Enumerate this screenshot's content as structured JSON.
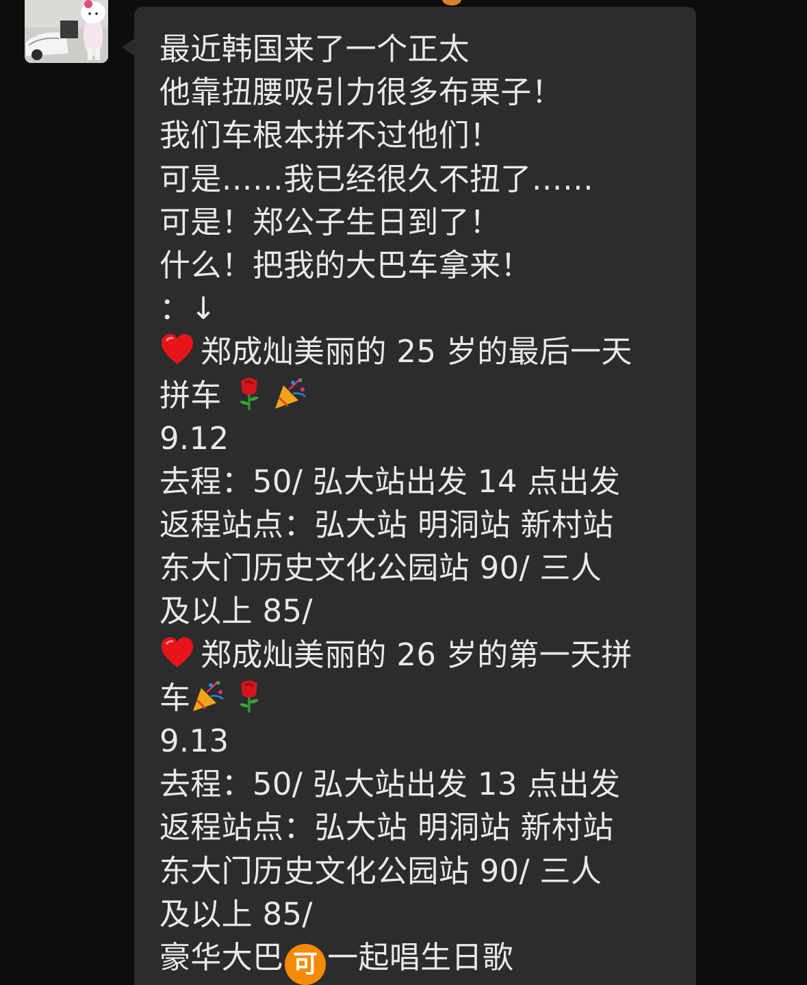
{
  "chat": {
    "avatar_icon": "hello-kitty-mascot-avatar",
    "message": {
      "line1": "最近韩国来了一个正太",
      "line2": "他靠扭腰吸引力很多布栗子！",
      "line3": "我们车根本拼不过他们！",
      "line4": "可是……我已经很久不扭了……",
      "line5": "可是！郑公子生日到了！",
      "line6": "什么！把我的大巴车拿来！",
      "line7": "：↓",
      "line8_icon": "red-heart-icon",
      "line8": "郑成灿美丽的 25 岁的最后一天",
      "line9": "拼车",
      "line9_icons": [
        "rose-icon",
        "party-popper-icon"
      ],
      "line10": "9.12",
      "line11": "去程：50/ 弘大站出发 14 点出发",
      "line12": "返程站点：弘大站 明洞站 新村站",
      "line13": "东大门历史文化公园站 90/ 三人",
      "line14": "及以上 85/",
      "line15_icon": "red-heart-icon",
      "line15": "郑成灿美丽的 26 岁的第一天拼",
      "line16": "车",
      "line16_icons": [
        "party-popper-icon",
        "rose-icon"
      ],
      "line17": "9.13",
      "line18": "去程：50/ 弘大站出发 13 点出发",
      "line19": "返程站点：弘大站 明洞站 新村站",
      "line20": "东大门历史文化公园站 90/ 三人",
      "line21": "及以上 85/",
      "line22_before": "豪华大巴",
      "line22_badge": "可",
      "line22_after": "一起唱生日歌"
    },
    "colors": {
      "background": "#0d0d0d",
      "bubble": "#2c2c2c",
      "text": "#e9e9e9",
      "badge": "#f58a07"
    }
  }
}
